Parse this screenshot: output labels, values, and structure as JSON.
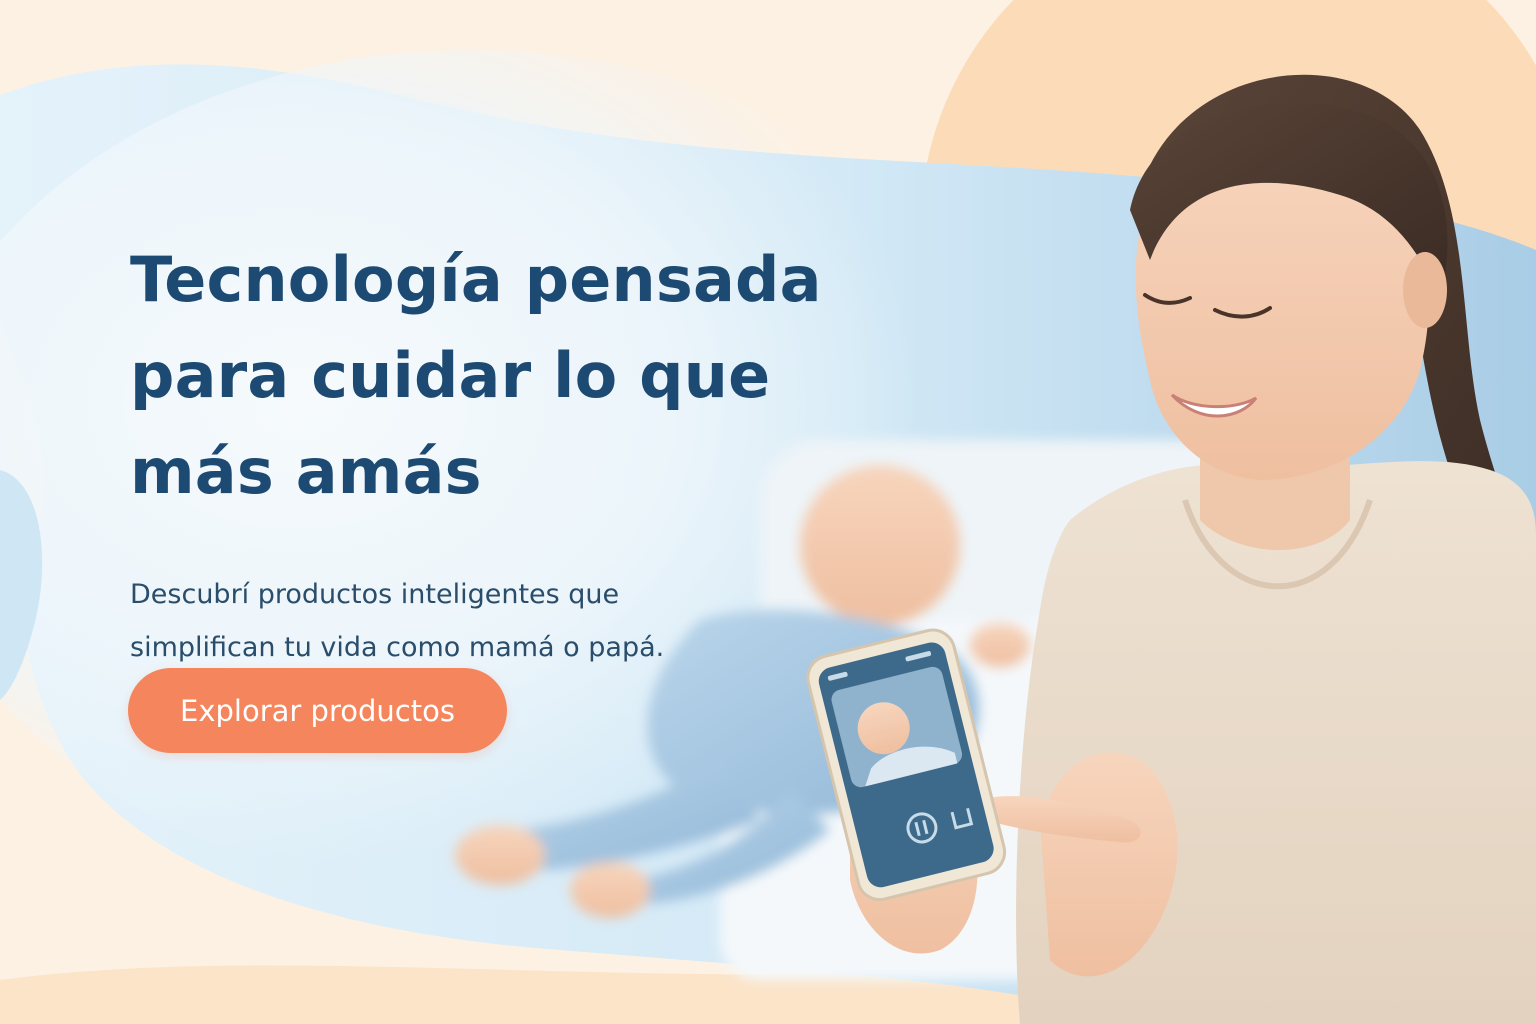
{
  "hero": {
    "headline_lines": [
      "Tecnología pensada",
      "para cuidar lo que",
      "más amás"
    ],
    "subtitle_lines": [
      "Descubrí productos inteligentes que",
      "simplifican tu vida como mamá o papá."
    ],
    "cta_label": "Explorar productos"
  },
  "colors": {
    "headline": "#1d4a72",
    "body_text": "#2a4d6b",
    "cta_background": "#f5855c",
    "cta_text": "#ffffff",
    "background_peach": "#fdf1e3",
    "background_blue": "#dbeef8"
  },
  "phone_screen": {
    "icons": [
      "pause-icon",
      "camera-switch-icon"
    ]
  }
}
